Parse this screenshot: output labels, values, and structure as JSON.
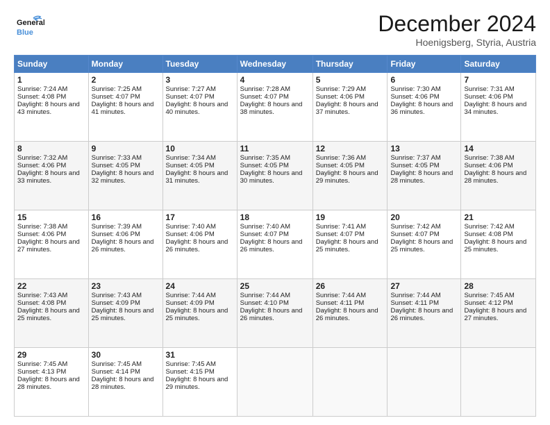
{
  "header": {
    "logo_general": "General",
    "logo_blue": "Blue",
    "month_title": "December 2024",
    "location": "Hoenigsberg, Styria, Austria"
  },
  "weekdays": [
    "Sunday",
    "Monday",
    "Tuesday",
    "Wednesday",
    "Thursday",
    "Friday",
    "Saturday"
  ],
  "rows": [
    [
      {
        "day": "1",
        "sunrise": "Sunrise: 7:24 AM",
        "sunset": "Sunset: 4:08 PM",
        "daylight": "Daylight: 8 hours and 43 minutes."
      },
      {
        "day": "2",
        "sunrise": "Sunrise: 7:25 AM",
        "sunset": "Sunset: 4:07 PM",
        "daylight": "Daylight: 8 hours and 41 minutes."
      },
      {
        "day": "3",
        "sunrise": "Sunrise: 7:27 AM",
        "sunset": "Sunset: 4:07 PM",
        "daylight": "Daylight: 8 hours and 40 minutes."
      },
      {
        "day": "4",
        "sunrise": "Sunrise: 7:28 AM",
        "sunset": "Sunset: 4:07 PM",
        "daylight": "Daylight: 8 hours and 38 minutes."
      },
      {
        "day": "5",
        "sunrise": "Sunrise: 7:29 AM",
        "sunset": "Sunset: 4:06 PM",
        "daylight": "Daylight: 8 hours and 37 minutes."
      },
      {
        "day": "6",
        "sunrise": "Sunrise: 7:30 AM",
        "sunset": "Sunset: 4:06 PM",
        "daylight": "Daylight: 8 hours and 36 minutes."
      },
      {
        "day": "7",
        "sunrise": "Sunrise: 7:31 AM",
        "sunset": "Sunset: 4:06 PM",
        "daylight": "Daylight: 8 hours and 34 minutes."
      }
    ],
    [
      {
        "day": "8",
        "sunrise": "Sunrise: 7:32 AM",
        "sunset": "Sunset: 4:06 PM",
        "daylight": "Daylight: 8 hours and 33 minutes."
      },
      {
        "day": "9",
        "sunrise": "Sunrise: 7:33 AM",
        "sunset": "Sunset: 4:05 PM",
        "daylight": "Daylight: 8 hours and 32 minutes."
      },
      {
        "day": "10",
        "sunrise": "Sunrise: 7:34 AM",
        "sunset": "Sunset: 4:05 PM",
        "daylight": "Daylight: 8 hours and 31 minutes."
      },
      {
        "day": "11",
        "sunrise": "Sunrise: 7:35 AM",
        "sunset": "Sunset: 4:05 PM",
        "daylight": "Daylight: 8 hours and 30 minutes."
      },
      {
        "day": "12",
        "sunrise": "Sunrise: 7:36 AM",
        "sunset": "Sunset: 4:05 PM",
        "daylight": "Daylight: 8 hours and 29 minutes."
      },
      {
        "day": "13",
        "sunrise": "Sunrise: 7:37 AM",
        "sunset": "Sunset: 4:05 PM",
        "daylight": "Daylight: 8 hours and 28 minutes."
      },
      {
        "day": "14",
        "sunrise": "Sunrise: 7:38 AM",
        "sunset": "Sunset: 4:06 PM",
        "daylight": "Daylight: 8 hours and 28 minutes."
      }
    ],
    [
      {
        "day": "15",
        "sunrise": "Sunrise: 7:38 AM",
        "sunset": "Sunset: 4:06 PM",
        "daylight": "Daylight: 8 hours and 27 minutes."
      },
      {
        "day": "16",
        "sunrise": "Sunrise: 7:39 AM",
        "sunset": "Sunset: 4:06 PM",
        "daylight": "Daylight: 8 hours and 26 minutes."
      },
      {
        "day": "17",
        "sunrise": "Sunrise: 7:40 AM",
        "sunset": "Sunset: 4:06 PM",
        "daylight": "Daylight: 8 hours and 26 minutes."
      },
      {
        "day": "18",
        "sunrise": "Sunrise: 7:40 AM",
        "sunset": "Sunset: 4:07 PM",
        "daylight": "Daylight: 8 hours and 26 minutes."
      },
      {
        "day": "19",
        "sunrise": "Sunrise: 7:41 AM",
        "sunset": "Sunset: 4:07 PM",
        "daylight": "Daylight: 8 hours and 25 minutes."
      },
      {
        "day": "20",
        "sunrise": "Sunrise: 7:42 AM",
        "sunset": "Sunset: 4:07 PM",
        "daylight": "Daylight: 8 hours and 25 minutes."
      },
      {
        "day": "21",
        "sunrise": "Sunrise: 7:42 AM",
        "sunset": "Sunset: 4:08 PM",
        "daylight": "Daylight: 8 hours and 25 minutes."
      }
    ],
    [
      {
        "day": "22",
        "sunrise": "Sunrise: 7:43 AM",
        "sunset": "Sunset: 4:08 PM",
        "daylight": "Daylight: 8 hours and 25 minutes."
      },
      {
        "day": "23",
        "sunrise": "Sunrise: 7:43 AM",
        "sunset": "Sunset: 4:09 PM",
        "daylight": "Daylight: 8 hours and 25 minutes."
      },
      {
        "day": "24",
        "sunrise": "Sunrise: 7:44 AM",
        "sunset": "Sunset: 4:09 PM",
        "daylight": "Daylight: 8 hours and 25 minutes."
      },
      {
        "day": "25",
        "sunrise": "Sunrise: 7:44 AM",
        "sunset": "Sunset: 4:10 PM",
        "daylight": "Daylight: 8 hours and 26 minutes."
      },
      {
        "day": "26",
        "sunrise": "Sunrise: 7:44 AM",
        "sunset": "Sunset: 4:11 PM",
        "daylight": "Daylight: 8 hours and 26 minutes."
      },
      {
        "day": "27",
        "sunrise": "Sunrise: 7:44 AM",
        "sunset": "Sunset: 4:11 PM",
        "daylight": "Daylight: 8 hours and 26 minutes."
      },
      {
        "day": "28",
        "sunrise": "Sunrise: 7:45 AM",
        "sunset": "Sunset: 4:12 PM",
        "daylight": "Daylight: 8 hours and 27 minutes."
      }
    ],
    [
      {
        "day": "29",
        "sunrise": "Sunrise: 7:45 AM",
        "sunset": "Sunset: 4:13 PM",
        "daylight": "Daylight: 8 hours and 28 minutes."
      },
      {
        "day": "30",
        "sunrise": "Sunrise: 7:45 AM",
        "sunset": "Sunset: 4:14 PM",
        "daylight": "Daylight: 8 hours and 28 minutes."
      },
      {
        "day": "31",
        "sunrise": "Sunrise: 7:45 AM",
        "sunset": "Sunset: 4:15 PM",
        "daylight": "Daylight: 8 hours and 29 minutes."
      },
      null,
      null,
      null,
      null
    ]
  ]
}
